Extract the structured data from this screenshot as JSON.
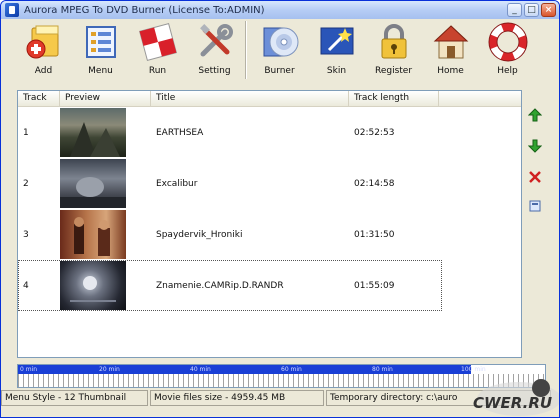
{
  "window": {
    "title": "Aurora MPEG To DVD Burner (License To:ADMIN)"
  },
  "title_buttons": {
    "minimize": "_",
    "maximize": "□",
    "close": "×"
  },
  "toolbar": {
    "items": [
      {
        "label": "Add",
        "icon": "add-icon"
      },
      {
        "label": "Menu",
        "icon": "menu-icon"
      },
      {
        "label": "Run",
        "icon": "run-flag-icon"
      },
      {
        "label": "Setting",
        "icon": "tools-icon"
      },
      {
        "label": "Burner",
        "icon": "disc-icon"
      },
      {
        "label": "Skin",
        "icon": "skin-wand-icon"
      },
      {
        "label": "Register",
        "icon": "lock-icon"
      },
      {
        "label": "Home",
        "icon": "home-icon"
      },
      {
        "label": "Help",
        "icon": "lifebuoy-icon"
      }
    ]
  },
  "list": {
    "columns": [
      "Track",
      "Preview",
      "Title",
      "Track length"
    ],
    "rows": [
      {
        "track": "1",
        "title": "EARTHSEA",
        "length": "02:52:53"
      },
      {
        "track": "2",
        "title": "Excalibur",
        "length": "02:14:58"
      },
      {
        "track": "3",
        "title": "Spaydervik_Hroniki",
        "length": "01:31:50"
      },
      {
        "track": "4",
        "title": "Znamenie.CAMRip.D.RANDR",
        "length": "01:55:09"
      }
    ]
  },
  "side_controls": {
    "move_up": "move-up-arrow-icon",
    "move_down": "move-down-arrow-icon",
    "delete": "delete-x-icon",
    "properties": "properties-icon"
  },
  "timeline": {
    "labels": [
      "0 min",
      "20 min",
      "40 min",
      "60 min",
      "80 min",
      "100 min"
    ],
    "fill_fraction": 0.86
  },
  "status": {
    "menu_style": "Menu Style - 12 Thumbnail",
    "files_size": "Movie files size - 4959.45 MB",
    "temp_dir": "Temporary directory: c:\\auro"
  },
  "watermark": "CWER.RU",
  "colors": {
    "accent": "#1a3fd6",
    "titlebar": "#b6cdf5"
  }
}
